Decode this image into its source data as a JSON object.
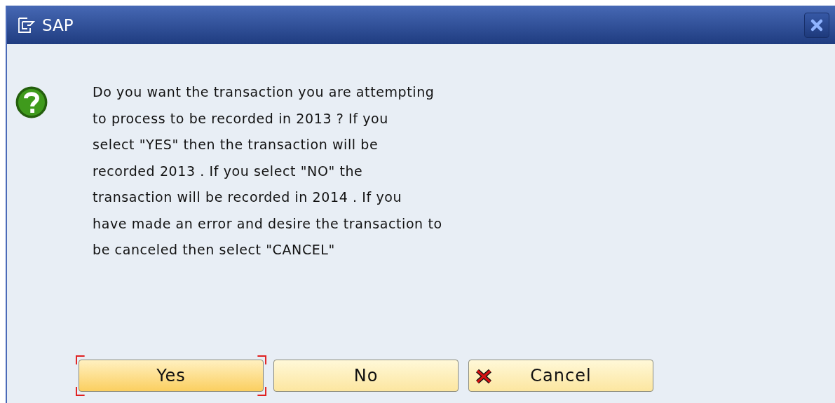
{
  "window": {
    "title": "SAP"
  },
  "message": {
    "lines": [
      "Do you want the transaction you are attempting",
      "to process to be recorded in 2013 ? If you",
      "select \"YES\" then the transaction will be",
      "recorded 2013 . If you select \"NO\" the",
      "transaction will be recorded in 2014 . If you",
      "have made an error and desire the transaction to",
      "be canceled then select \"CANCEL\""
    ]
  },
  "buttons": [
    {
      "label": "Yes",
      "kind": "plain",
      "selected": true
    },
    {
      "label": "No",
      "kind": "plain",
      "selected": false
    },
    {
      "label": "Cancel",
      "kind": "cancel",
      "selected": false
    }
  ]
}
